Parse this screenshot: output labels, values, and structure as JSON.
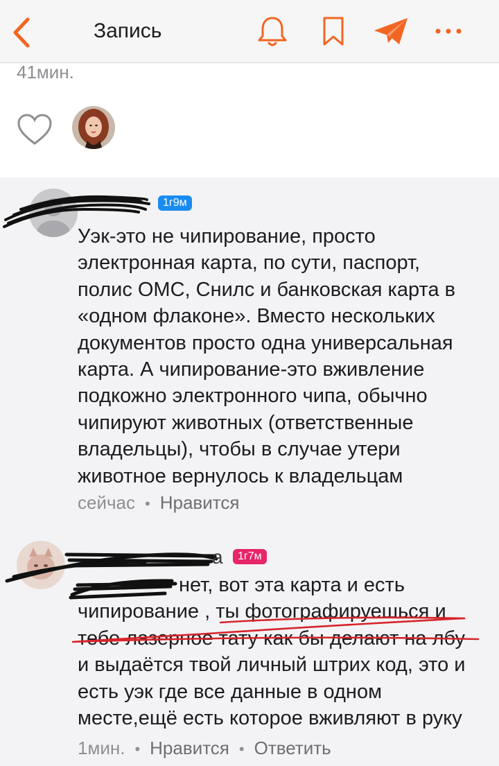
{
  "header": {
    "title": "Запись",
    "icons": [
      "chevron-left-icon",
      "bell-icon",
      "bookmark-icon",
      "send-icon",
      "more-dots-icon"
    ],
    "accent_color": "#f26522"
  },
  "post": {
    "time": "41мин.",
    "like_icon": "heart-outline-icon"
  },
  "comments": [
    {
      "badge": "1г9м",
      "badge_color": "#1a8cf0",
      "text_lines": [
        "Уэк-это не чипирование, просто",
        "электронная карта, по сути, паспорт,",
        "полис ОМС, Снилс и банковская карта в",
        "«одном флаконе». Вместо нескольких",
        "документов просто одна универсальная",
        "карта. А чипирование-это вживление",
        "подкожно электронного чипа, обычно",
        "чипируют животных (ответственные",
        "владельцы), чтобы в случае утери",
        "животное вернулось к владельцам"
      ],
      "time": "сейчас",
      "like_label": "Нравится"
    },
    {
      "username_tail": "a",
      "badge": "1г7м",
      "badge_color": "#e8246a",
      "text_lines": [
        "нет, вот эта карта и есть",
        "чипирование , ты фотографируешься и",
        "тебе лазерное тату как бы делают на лбу",
        "и выдаётся твой личный штрих код, это и",
        "есть уэк где все данные в одном",
        "месте,ещё есть которое вживляют в руку"
      ],
      "time": "1мин.",
      "like_label": "Нравится",
      "reply_label": "Ответить"
    }
  ]
}
